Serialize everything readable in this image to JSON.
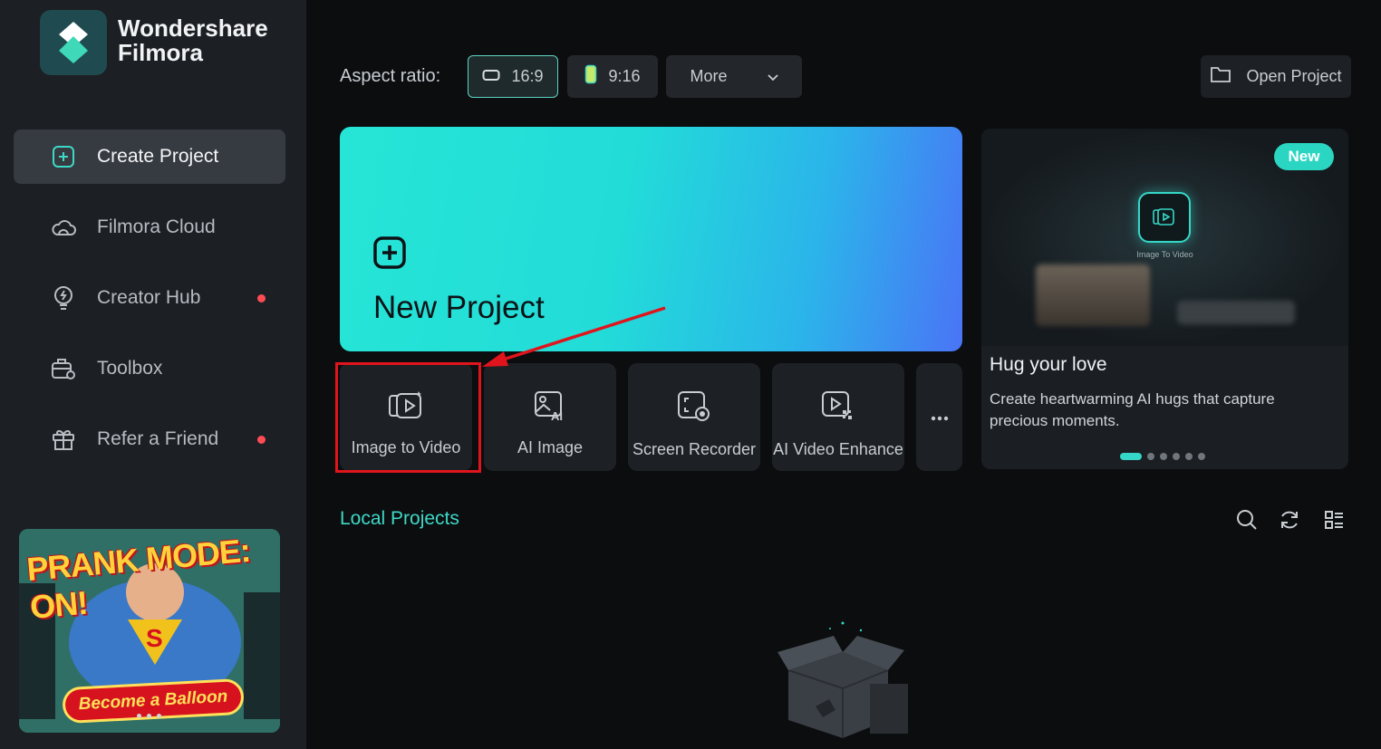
{
  "app": {
    "brand_line1": "Wondershare",
    "brand_line2": "Filmora"
  },
  "sidebar": {
    "items": [
      {
        "label": "Create Project",
        "icon": "plus-square-icon",
        "active": true
      },
      {
        "label": "Filmora Cloud",
        "icon": "cloud-icon"
      },
      {
        "label": "Creator Hub",
        "icon": "bulb-icon",
        "notification": true
      },
      {
        "label": "Toolbox",
        "icon": "toolbox-icon"
      },
      {
        "label": "Refer a Friend",
        "icon": "gift-icon",
        "notification": true
      }
    ],
    "promo": {
      "title": "PRANK MODE: ON!",
      "subtitle": "Become a Balloon"
    }
  },
  "topbar": {
    "aspect_label": "Aspect ratio:",
    "ratio_16_9": "16:9",
    "ratio_9_16": "9:16",
    "more_label": "More",
    "open_project_label": "Open Project"
  },
  "new_project": {
    "label": "New Project"
  },
  "tools": [
    {
      "label": "Image to Video",
      "icon": "image-to-video-icon"
    },
    {
      "label": "AI Image",
      "icon": "ai-image-icon"
    },
    {
      "label": "Screen Recorder",
      "icon": "screen-recorder-icon"
    },
    {
      "label": "AI Video Enhance",
      "icon": "ai-video-enhance-icon"
    }
  ],
  "banner": {
    "badge": "New",
    "caption": "Image To Video",
    "title": "Hug your love",
    "description": "Create heartwarming AI hugs that capture precious moments."
  },
  "local_projects": {
    "title": "Local Projects"
  },
  "colors": {
    "accent": "#35d8c8",
    "highlight": "#e0141c",
    "notification": "#ff4b55"
  }
}
